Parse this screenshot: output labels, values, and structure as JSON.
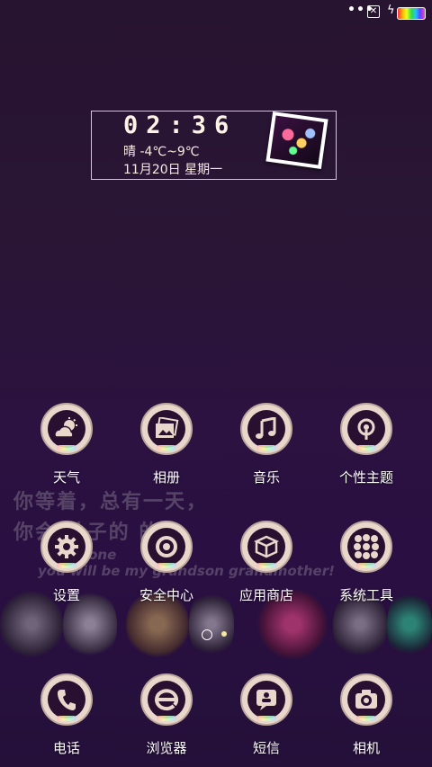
{
  "status_bar": {
    "icons": [
      "more-dots-icon",
      "no-sim-icon",
      "charging-bolt-icon",
      "battery-icon"
    ],
    "dots": "•••",
    "sim_glyph": "✕",
    "bolt_glyph": "ϟ"
  },
  "widget": {
    "time": "02:36",
    "weather": "晴 -4℃~9℃",
    "date": "11月20日 星期一"
  },
  "wallpaper_text": {
    "line1": "你等着，总有一天，",
    "line2": "你会  孙子的  的！",
    "line3": "t, one",
    "line4": "you will be my grandson grandmother!"
  },
  "apps_row1": [
    {
      "label": "天气",
      "icon": "weather-icon"
    },
    {
      "label": "相册",
      "icon": "gallery-icon"
    },
    {
      "label": "音乐",
      "icon": "music-icon"
    },
    {
      "label": "个性主题",
      "icon": "theme-icon"
    }
  ],
  "apps_row2": [
    {
      "label": "设置",
      "icon": "settings-icon"
    },
    {
      "label": "安全中心",
      "icon": "security-icon"
    },
    {
      "label": "应用商店",
      "icon": "app-store-icon"
    },
    {
      "label": "系统工具",
      "icon": "system-tools-icon"
    }
  ],
  "dock": [
    {
      "label": "电话",
      "icon": "phone-icon"
    },
    {
      "label": "浏览器",
      "icon": "browser-icon"
    },
    {
      "label": "短信",
      "icon": "sms-icon"
    },
    {
      "label": "相机",
      "icon": "camera-icon"
    }
  ],
  "pager": {
    "pages": 2,
    "current": 1
  },
  "colors": {
    "background": "#2a1536",
    "icon_ring": "#e9d7cc",
    "icon_core": "#2a1030",
    "label": "#ffffff"
  }
}
